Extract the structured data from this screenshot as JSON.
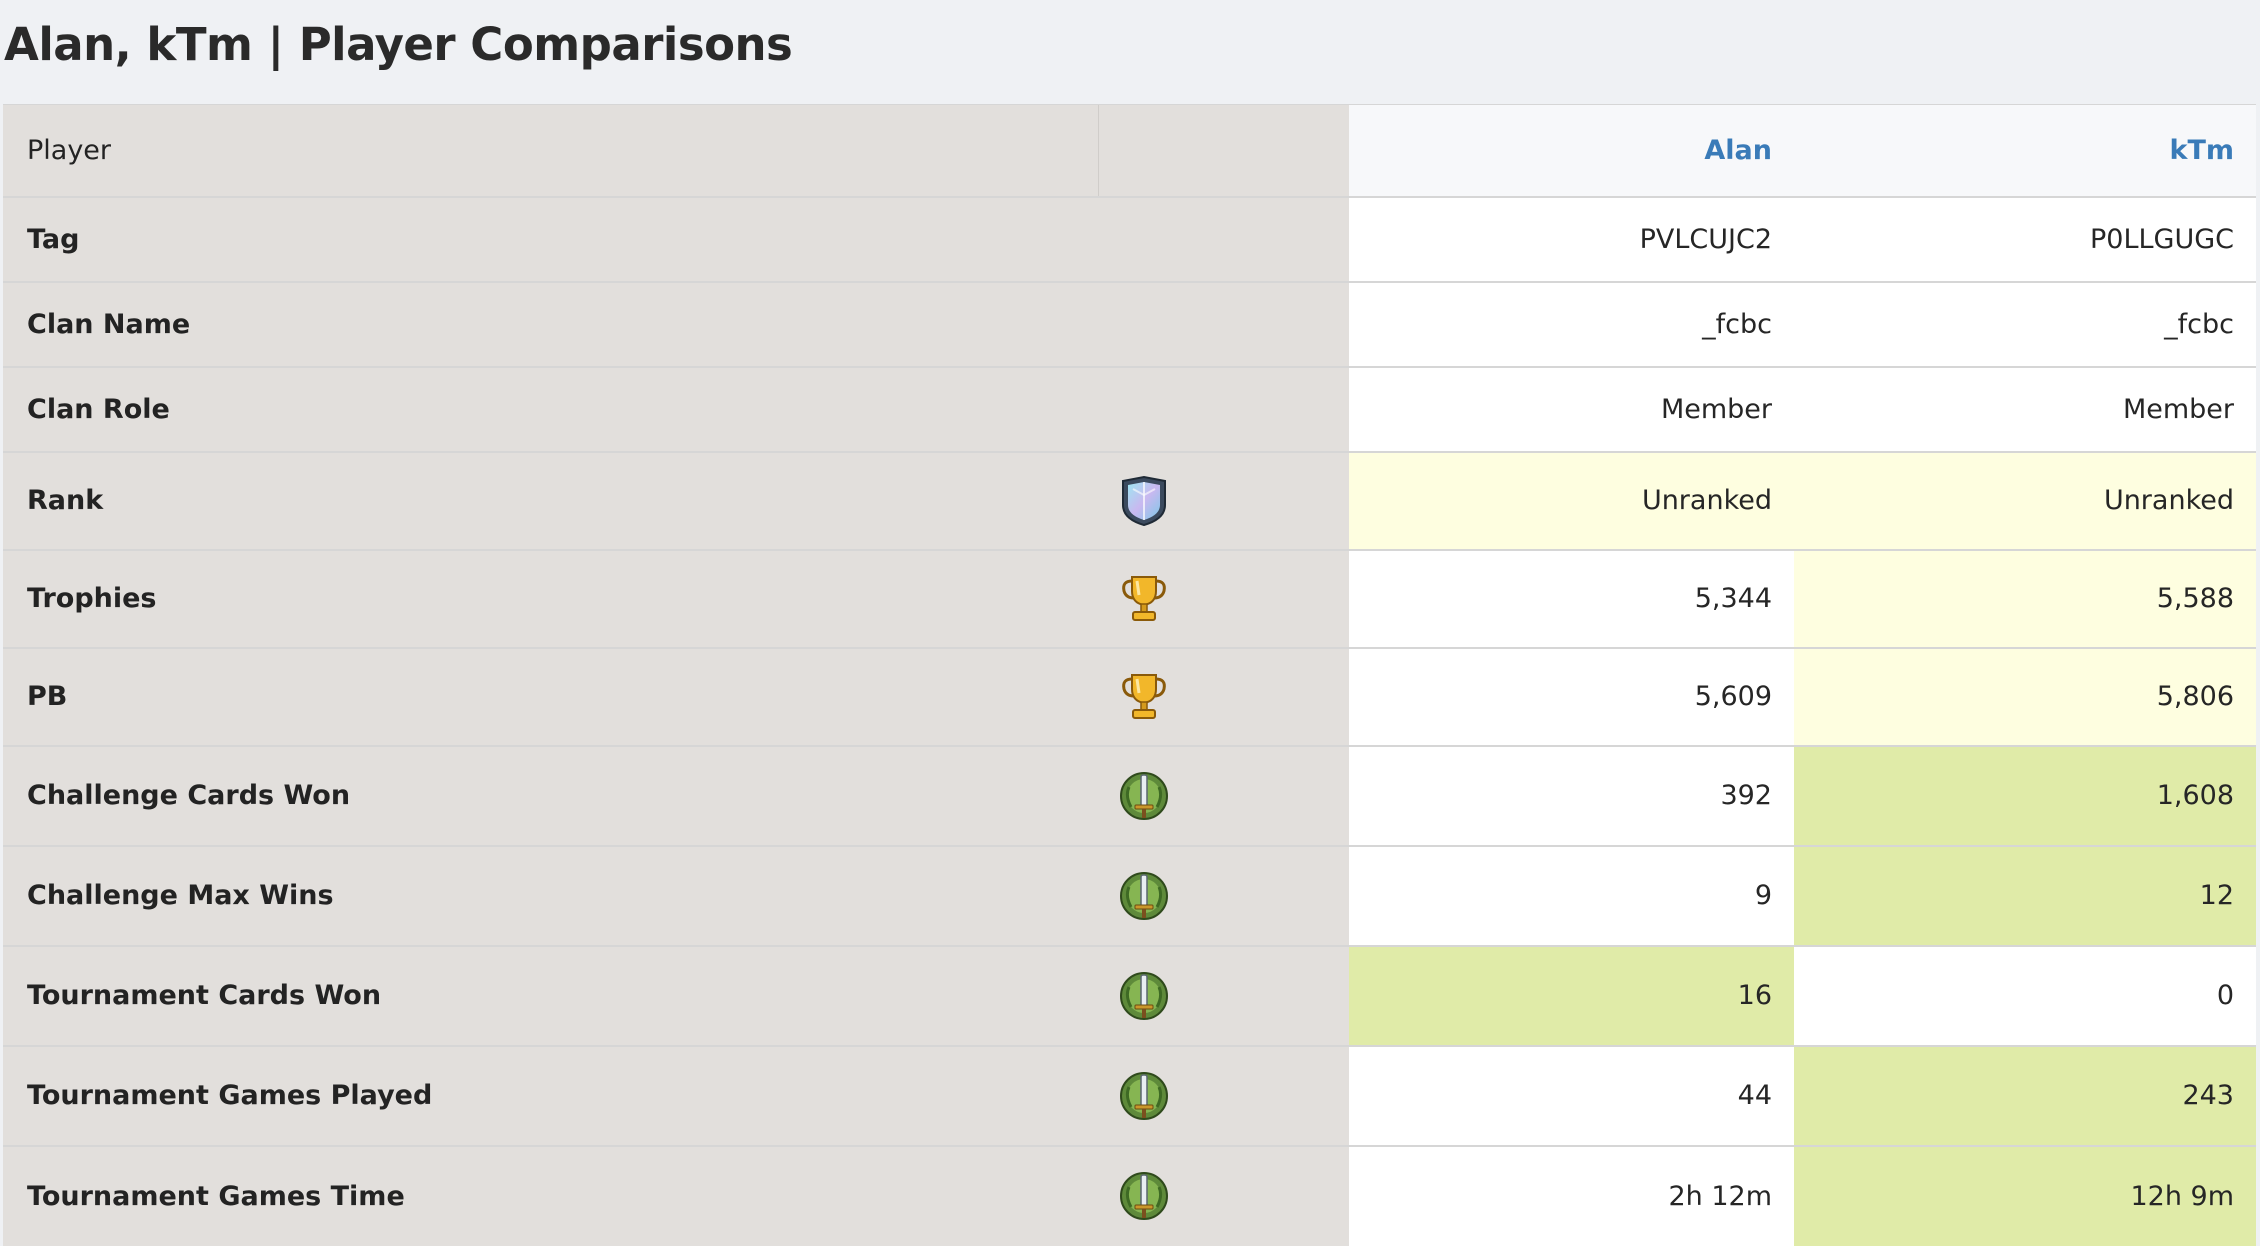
{
  "page": {
    "title": "Alan, kTm | Player Comparisons"
  },
  "header": {
    "label": "Player",
    "players": [
      "Alan",
      "kTm"
    ]
  },
  "rows": [
    {
      "label": "Tag",
      "icon": "none",
      "values": [
        "PVLCUJC2",
        "P0LLGUGC"
      ],
      "highlight": [
        "none",
        "none"
      ]
    },
    {
      "label": "Clan Name",
      "icon": "none",
      "values": [
        "_fcbc",
        "_fcbc"
      ],
      "highlight": [
        "none",
        "none"
      ]
    },
    {
      "label": "Clan Role",
      "icon": "none",
      "values": [
        "Member",
        "Member"
      ],
      "highlight": [
        "none",
        "none"
      ]
    },
    {
      "label": "Rank",
      "icon": "rank-shield-icon",
      "values": [
        "Unranked",
        "Unranked"
      ],
      "highlight": [
        "light",
        "light"
      ]
    },
    {
      "label": "Trophies",
      "icon": "trophy-icon",
      "values": [
        "5,344",
        "5,588"
      ],
      "highlight": [
        "none",
        "light"
      ]
    },
    {
      "label": "PB",
      "icon": "trophy-icon",
      "values": [
        "5,609",
        "5,806"
      ],
      "highlight": [
        "none",
        "light"
      ]
    },
    {
      "label": "Challenge Cards Won",
      "icon": "laurel-sword-icon",
      "values": [
        "392",
        "1,608"
      ],
      "highlight": [
        "none",
        "green"
      ]
    },
    {
      "label": "Challenge Max Wins",
      "icon": "laurel-sword-icon",
      "values": [
        "9",
        "12"
      ],
      "highlight": [
        "none",
        "green"
      ]
    },
    {
      "label": "Tournament Cards Won",
      "icon": "laurel-sword-icon",
      "values": [
        "16",
        "0"
      ],
      "highlight": [
        "green",
        "none"
      ]
    },
    {
      "label": "Tournament Games Played",
      "icon": "laurel-sword-icon",
      "values": [
        "44",
        "243"
      ],
      "highlight": [
        "none",
        "green"
      ]
    },
    {
      "label": "Tournament Games Time",
      "icon": "laurel-sword-icon",
      "values": [
        "2h 12m",
        "12h 9m"
      ],
      "highlight": [
        "none",
        "green"
      ]
    }
  ],
  "colors": {
    "label_bg": "#e2dfdc",
    "highlight_light": "#fefee0",
    "highlight_green": "#e0eba8",
    "link": "#3a7bb8"
  }
}
